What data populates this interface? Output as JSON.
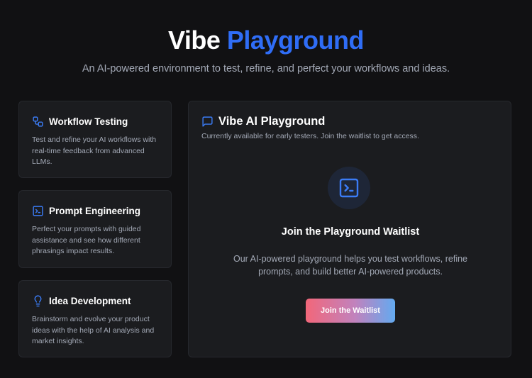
{
  "hero": {
    "title_prefix": "Vibe",
    "title_accent": "Playground",
    "subtitle": "An AI-powered environment to test, refine, and perfect your workflows and ideas."
  },
  "features": [
    {
      "icon": "workflow-icon",
      "title": "Workflow Testing",
      "description": "Test and refine your AI workflows with real-time feedback from advanced LLMs."
    },
    {
      "icon": "terminal-icon",
      "title": "Prompt Engineering",
      "description": "Perfect your prompts with guided assistance and see how different phrasings impact results."
    },
    {
      "icon": "lightbulb-icon",
      "title": "Idea Development",
      "description": "Brainstorm and evolve your product ideas with the help of AI analysis and market insights."
    }
  ],
  "playground": {
    "icon": "message-square-icon",
    "title": "Vibe AI Playground",
    "subtitle": "Currently available for early testers. Join the waitlist to get access.",
    "center_icon": "terminal-icon",
    "waitlist_title": "Join the Playground Waitlist",
    "waitlist_description": "Our AI-powered playground helps you test workflows, refine prompts, and build better AI-powered products.",
    "button_label": "Join the Waitlist"
  },
  "colors": {
    "background": "#111113",
    "card": "#1b1c1f",
    "accent": "#2f6df6",
    "muted_text": "#a3a9b6",
    "button_gradient": [
      "#f2677a",
      "#c182bd",
      "#63aaf0"
    ]
  }
}
